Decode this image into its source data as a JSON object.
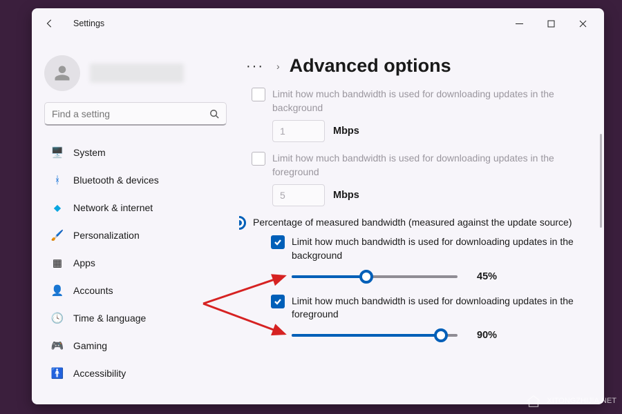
{
  "titlebar": {
    "title": "Settings"
  },
  "search": {
    "placeholder": "Find a setting"
  },
  "sidebar": {
    "items": [
      {
        "label": "System"
      },
      {
        "label": "Bluetooth & devices"
      },
      {
        "label": "Network & internet"
      },
      {
        "label": "Personalization"
      },
      {
        "label": "Apps"
      },
      {
        "label": "Accounts"
      },
      {
        "label": "Time & language"
      },
      {
        "label": "Gaming"
      },
      {
        "label": "Accessibility"
      }
    ]
  },
  "page": {
    "title": "Advanced options",
    "abs_bg": {
      "label": "Limit how much bandwidth is used for downloading updates in the background",
      "value": "1",
      "unit": "Mbps"
    },
    "abs_fg": {
      "label": "Limit how much bandwidth is used for downloading updates in the foreground",
      "value": "5",
      "unit": "Mbps"
    },
    "radio": {
      "label": "Percentage of measured bandwidth (measured against the update source)"
    },
    "pct_bg": {
      "label": "Limit how much bandwidth is used for downloading updates in the background",
      "value": 45,
      "display": "45%"
    },
    "pct_fg": {
      "label": "Limit how much bandwidth is used for downloading updates in the foreground",
      "value": 90,
      "display": "90%"
    }
  },
  "watermark": "XITONGZHIJIA.NET",
  "colors": {
    "accent": "#005fb8"
  }
}
